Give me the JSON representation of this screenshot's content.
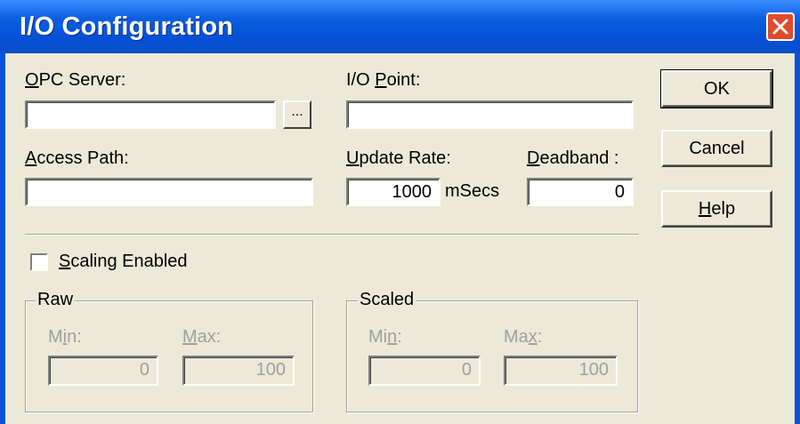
{
  "window": {
    "title": "I/O Configuration"
  },
  "fields": {
    "opc_server": {
      "label_pre": "",
      "label_key": "O",
      "label_post": "PC Server:",
      "value": ""
    },
    "browse_label": "...",
    "io_point": {
      "label_pre": "I/O ",
      "label_key": "P",
      "label_post": "oint:",
      "value": ""
    },
    "access_path": {
      "label_pre": "",
      "label_key": "A",
      "label_post": "ccess Path:",
      "value": ""
    },
    "update_rate": {
      "label_pre": "",
      "label_key": "U",
      "label_post": "pdate Rate:",
      "value": "1000",
      "unit": "mSecs"
    },
    "deadband": {
      "label_pre": "",
      "label_key": "D",
      "label_post": "eadband :",
      "value": "0"
    }
  },
  "buttons": {
    "ok": "OK",
    "cancel": "Cancel",
    "help_key": "H",
    "help_rest": "elp"
  },
  "scaling": {
    "checkbox_key": "S",
    "checkbox_rest": "caling Enabled",
    "checked": false,
    "raw": {
      "title": "Raw",
      "min_pre": "M",
      "min_key": "i",
      "min_post": "n:",
      "max_pre": "",
      "max_key": "M",
      "max_post": "ax:",
      "min_value": "0",
      "max_value": "100"
    },
    "scaled": {
      "title": "Scaled",
      "min_pre": "Mi",
      "min_key": "n",
      "min_post": ":",
      "max_pre": "Ma",
      "max_key": "x",
      "max_post": ":",
      "min_value": "0",
      "max_value": "100"
    }
  },
  "colors": {
    "titlebar": "#0a5fe0",
    "dialog_bg": "#ece9d8",
    "close_button": "#e04a2a",
    "disabled_text": "#a0a0a0"
  }
}
